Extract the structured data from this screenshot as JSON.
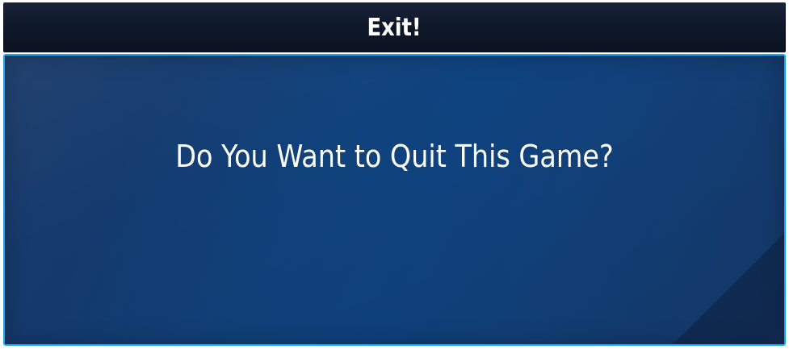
{
  "dialog": {
    "title": "Exit!",
    "message": "Do You Want to Quit This Game?"
  },
  "colors": {
    "title_bar": "#0f1829",
    "panel_bg": "#10427c",
    "panel_border": "#1aa8f2",
    "text": "#ffffff"
  }
}
